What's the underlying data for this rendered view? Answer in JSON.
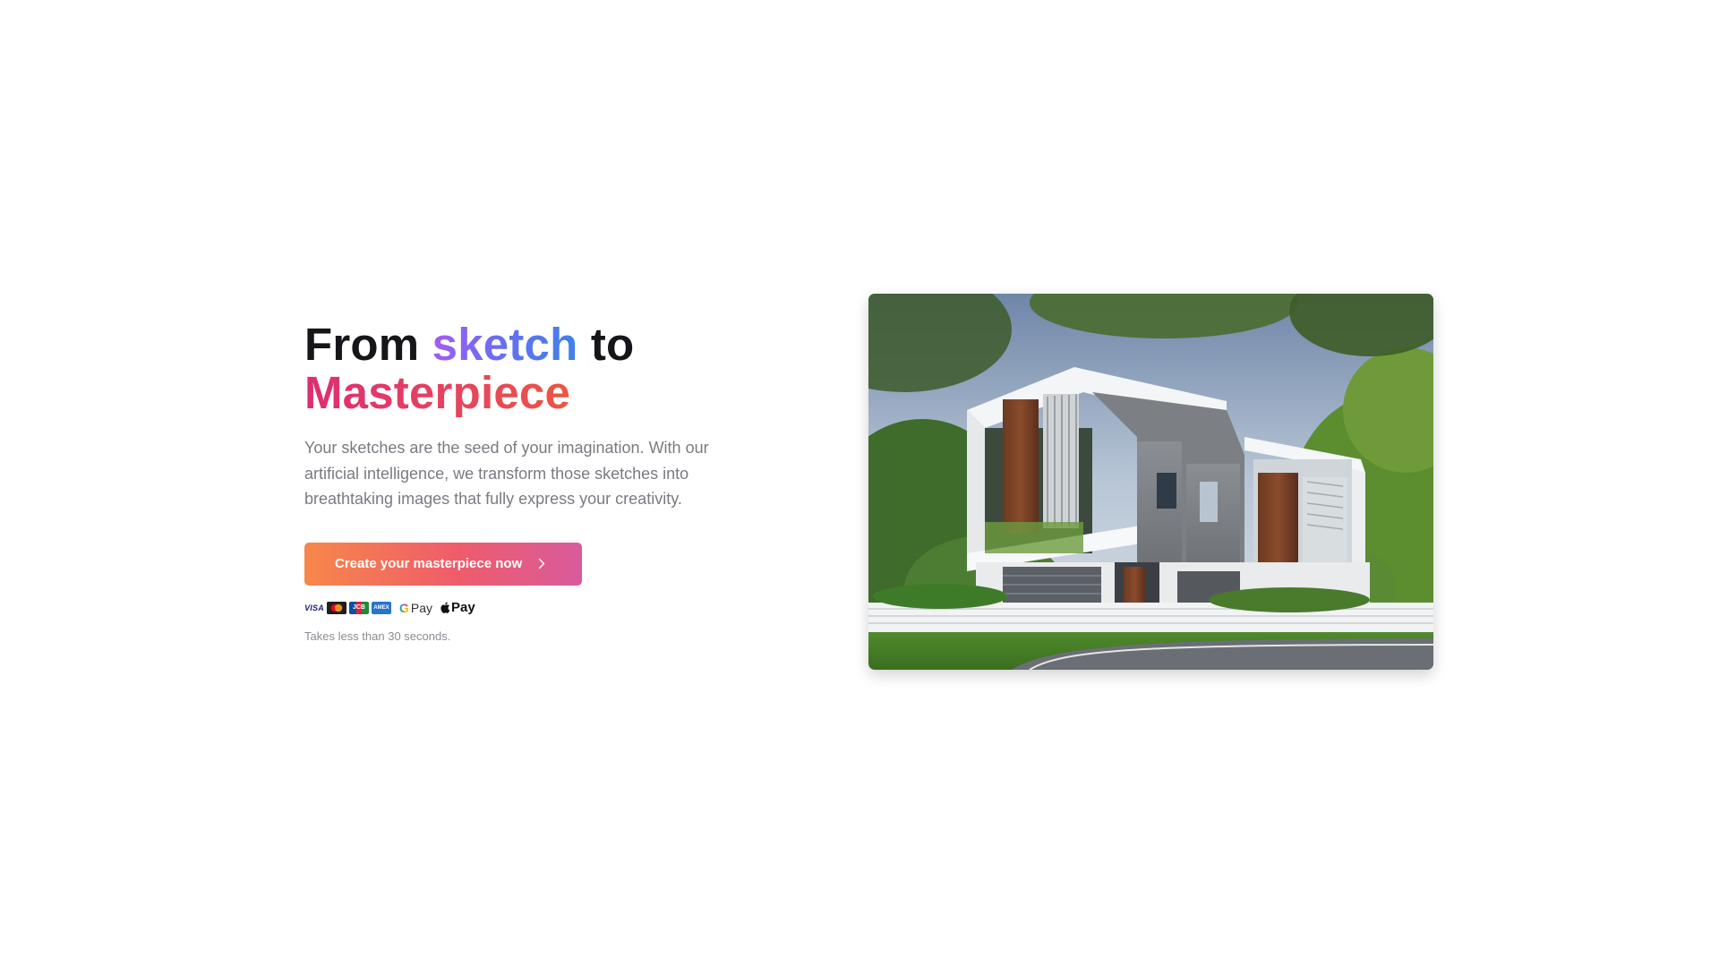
{
  "hero": {
    "headline": {
      "part1": "From ",
      "highlight1": "sketch",
      "part2": " to",
      "highlight2": "Masterpiece"
    },
    "description": "Your sketches are the seed of your imagination. With our artificial intelligence, we transform those sketches into breathtaking images that fully express your creativity.",
    "cta_label": "Create your masterpiece now",
    "payment_methods": [
      {
        "name": "visa",
        "label": "VISA"
      },
      {
        "name": "mastercard",
        "label": ""
      },
      {
        "name": "jcb",
        "label": "JCB"
      },
      {
        "name": "amex",
        "label": "AMEX"
      },
      {
        "name": "google-pay",
        "label": "Pay"
      },
      {
        "name": "apple-pay",
        "label": "Pay"
      }
    ],
    "note": "Takes less than 30 seconds."
  },
  "colors": {
    "heading": "#16161a",
    "body_text": "#7a7a82",
    "cta_gradient_start": "#f7874a",
    "cta_gradient_end": "#d95b9c",
    "sketch_gradient": [
      "#a35cf2",
      "#3f82e8"
    ],
    "masterpiece_gradient": [
      "#dc2e73",
      "#f07a1e"
    ]
  },
  "image": {
    "alt": "modern-white-house-render"
  }
}
